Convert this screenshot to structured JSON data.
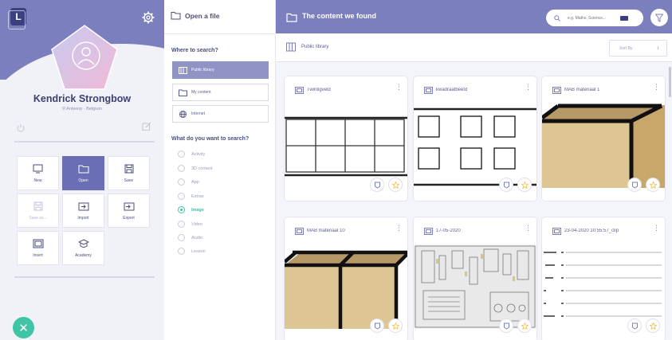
{
  "colors": {
    "primary": "#7b7fbd",
    "accent": "#3fc4a5",
    "dark": "#3c3f80",
    "star": "#f2c14e"
  },
  "app": {
    "logo_letter": "L"
  },
  "profile": {
    "name": "Kendrick Strongbow",
    "location": "Antwerp - Belgium"
  },
  "actions": [
    {
      "label": "New",
      "icon": "new-file-icon",
      "state": "normal"
    },
    {
      "label": "Open",
      "icon": "open-folder-icon",
      "state": "active"
    },
    {
      "label": "Save",
      "icon": "save-icon",
      "state": "normal"
    },
    {
      "label": "Save as...",
      "icon": "save-as-icon",
      "state": "disabled"
    },
    {
      "label": "Import",
      "icon": "import-icon",
      "state": "normal"
    },
    {
      "label": "Export",
      "icon": "export-icon",
      "state": "normal"
    },
    {
      "label": "Insert",
      "icon": "insert-image-icon",
      "state": "normal"
    },
    {
      "label": "Academy",
      "icon": "academy-icon",
      "state": "normal"
    }
  ],
  "open_panel": {
    "title": "Open a file",
    "where_label": "Where to search?",
    "sources": [
      {
        "label": "Public library",
        "selected": true
      },
      {
        "label": "My content",
        "selected": false
      },
      {
        "label": "Internet",
        "selected": false
      }
    ],
    "what_label": "What do you want to search?",
    "types": [
      {
        "label": "Activity",
        "checked": false
      },
      {
        "label": "3D content",
        "checked": false
      },
      {
        "label": "App",
        "checked": false
      },
      {
        "label": "Extras",
        "checked": false
      },
      {
        "label": "Image",
        "checked": true
      },
      {
        "label": "Video",
        "checked": false
      },
      {
        "label": "Audio",
        "checked": false
      },
      {
        "label": "Lesson",
        "checked": false
      }
    ]
  },
  "results": {
    "title": "The content we found",
    "search_placeholder": "e.g. Maths, Science...",
    "breadcrumb": "Public library",
    "sort_label": "Sort By",
    "cards": [
      {
        "title": "Twintigveld",
        "thumb": "grid"
      },
      {
        "title": "kwadraatbeeld",
        "thumb": "squares"
      },
      {
        "title": "MAB materiaal 1",
        "thumb": "cube"
      },
      {
        "title": "MAB materiaal 10",
        "thumb": "bar"
      },
      {
        "title": "17-05-2020",
        "thumb": "photo"
      },
      {
        "title": "23-04-2020 10:55:57_clip",
        "thumb": "lines"
      }
    ]
  }
}
